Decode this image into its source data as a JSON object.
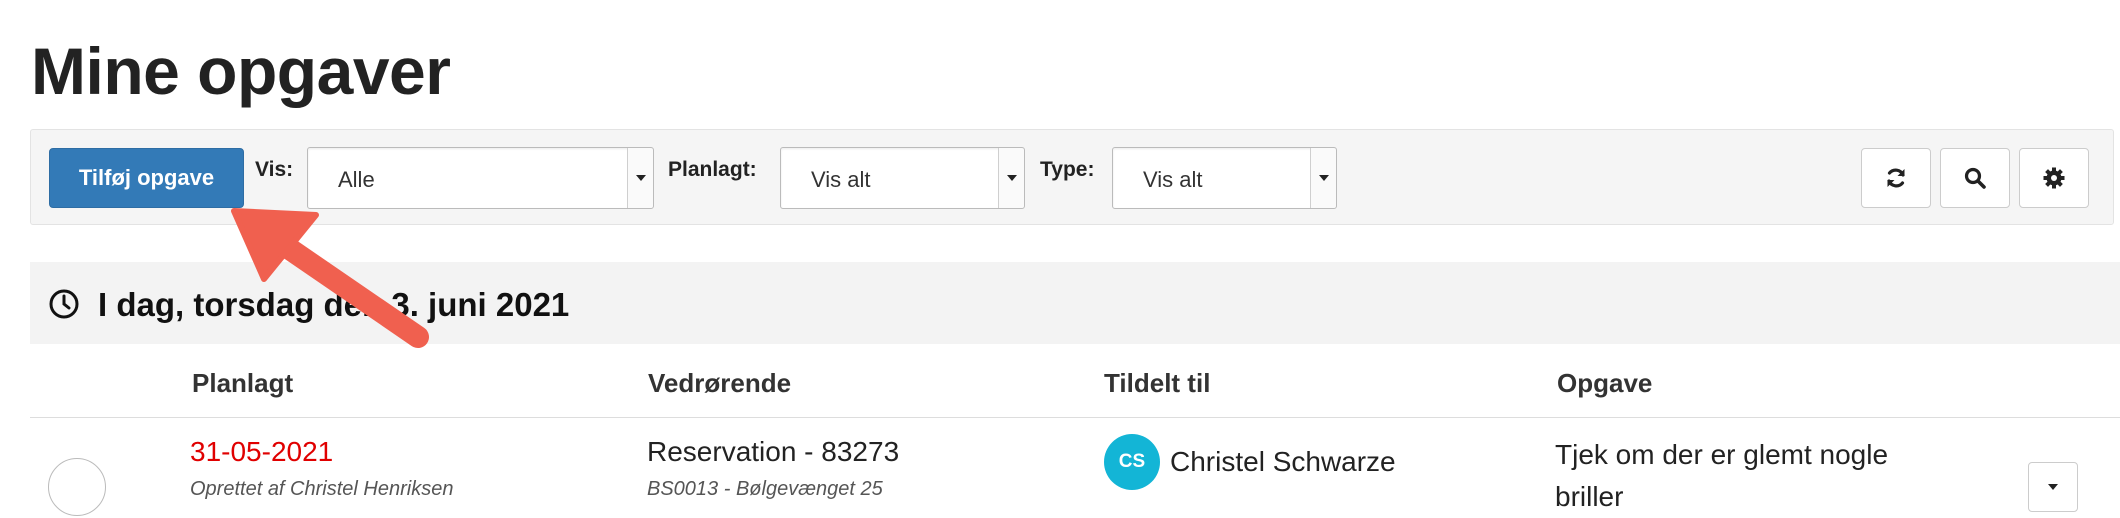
{
  "page": {
    "title": "Mine opgaver"
  },
  "toolbar": {
    "add_button": "Tilføj opgave",
    "filters": [
      {
        "label": "Vis:",
        "value": "Alle"
      },
      {
        "label": "Planlagt:",
        "value": "Vis alt"
      },
      {
        "label": "Type:",
        "value": "Vis alt"
      }
    ],
    "icons": [
      "refresh-icon",
      "search-icon",
      "gear-icon"
    ]
  },
  "section": {
    "title": "I dag, torsdag den 3. juni 2021",
    "icon": "clock-icon"
  },
  "table": {
    "columns": [
      "Planlagt",
      "Vedrørende",
      "Tildelt til",
      "Opgave"
    ],
    "rows": [
      {
        "date": "31-05-2021",
        "created_by": "Oprettet af Christel Henriksen",
        "regarding": "Reservation - 83273",
        "regarding_sub": "BS0013 - Bølgevænget 25",
        "regarding_sub2": "",
        "assignee_initials": "CS",
        "assignee": "Christel Schwarze",
        "task": "Tjek om der er glemt nogle briller"
      }
    ]
  },
  "colors": {
    "primary": "#337ab7",
    "overdue": "#e00000",
    "avatar": "#13b5d6",
    "annotation_arrow": "#f0604f"
  }
}
